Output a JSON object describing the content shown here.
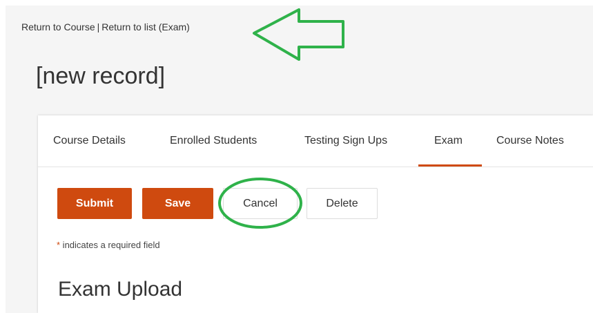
{
  "breadcrumb": {
    "return_to_course": "Return to Course",
    "separator": "|",
    "return_to_list": "Return to list (Exam)"
  },
  "page_title": "[new record]",
  "tabs": [
    {
      "label": "Course Details",
      "active": false
    },
    {
      "label": "Enrolled Students",
      "active": false
    },
    {
      "label": "Testing Sign Ups",
      "active": false
    },
    {
      "label": "Exam",
      "active": true
    },
    {
      "label": "Course Notes",
      "active": false
    }
  ],
  "actions": {
    "submit": "Submit",
    "save": "Save",
    "cancel": "Cancel",
    "delete": "Delete"
  },
  "required_note": {
    "star": "*",
    "text": " indicates a required field"
  },
  "section_title": "Exam Upload",
  "colors": {
    "accent": "#cf4a0f",
    "annotation": "#2fb24a"
  },
  "annotations": {
    "arrow": "arrow-left-outline",
    "circle": "ellipse-highlight"
  }
}
